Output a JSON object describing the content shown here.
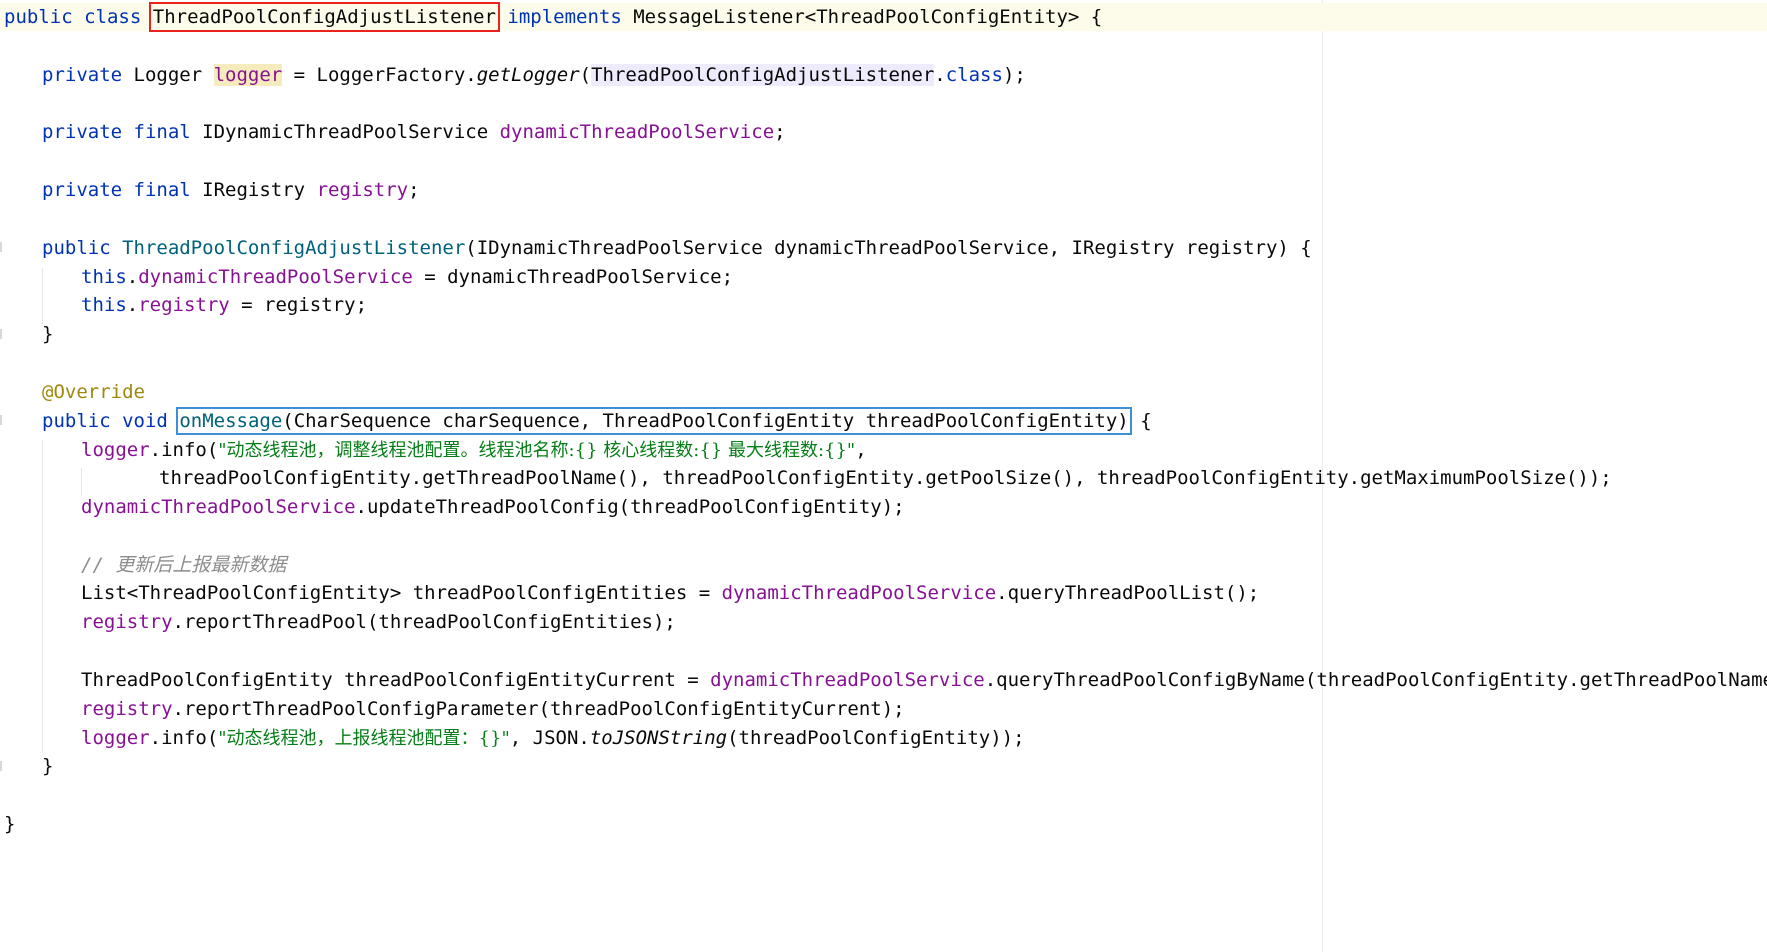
{
  "editor": {
    "language": "Java",
    "lines": [
      {
        "tokens": [
          "public",
          " ",
          "class",
          " ",
          "ThreadPoolConfigAdjustListener",
          " ",
          "implements",
          " ",
          "MessageListener<ThreadPoolConfigEntity> {"
        ]
      },
      {
        "tokens": [
          "private",
          " Logger ",
          "logger",
          " = LoggerFactory.",
          "getLogger",
          "(",
          "ThreadPoolConfigAdjustListener",
          ".",
          "class",
          ");"
        ]
      },
      {
        "tokens": [
          "private",
          " ",
          "final",
          " IDynamicThreadPoolService ",
          "dynamicThreadPoolService",
          ";"
        ]
      },
      {
        "tokens": [
          "private",
          " ",
          "final",
          " IRegistry ",
          "registry",
          ";"
        ]
      },
      {
        "tokens": [
          "public",
          " ",
          "ThreadPoolConfigAdjustListener",
          "(IDynamicThreadPoolService dynamicThreadPoolService, IRegistry registry) {"
        ]
      },
      {
        "tokens": [
          "this",
          ".",
          "dynamicThreadPoolService",
          " = dynamicThreadPoolService;"
        ]
      },
      {
        "tokens": [
          "this",
          ".",
          "registry",
          " = registry;"
        ]
      },
      {
        "tokens": [
          "}"
        ]
      },
      {
        "tokens": [
          "@Override"
        ]
      },
      {
        "tokens": [
          "public",
          " ",
          "void",
          " ",
          "onMessage",
          "(CharSequence charSequence, ThreadPoolConfigEntity threadPoolConfigEntity)",
          " {"
        ]
      },
      {
        "tokens": [
          "logger",
          ".info(",
          "\"动态线程池，调整线程池配置。线程池名称:{} 核心线程数:{} 最大线程数:{}\"",
          ","
        ]
      },
      {
        "tokens": [
          "threadPoolConfigEntity.getThreadPoolName(), threadPoolConfigEntity.getPoolSize(), threadPoolConfigEntity.getMaximumPoolSize());"
        ]
      },
      {
        "tokens": [
          "dynamicThreadPoolService",
          ".updateThreadPoolConfig(threadPoolConfigEntity);"
        ]
      },
      {
        "tokens": [
          "// 更新后上报最新数据"
        ]
      },
      {
        "tokens": [
          "List<ThreadPoolConfigEntity> threadPoolConfigEntities = ",
          "dynamicThreadPoolService",
          ".queryThreadPoolList();"
        ]
      },
      {
        "tokens": [
          "registry",
          ".reportThreadPool(threadPoolConfigEntities);"
        ]
      },
      {
        "tokens": [
          "ThreadPoolConfigEntity threadPoolConfigEntityCurrent = ",
          "dynamicThreadPoolService",
          ".queryThreadPoolConfigByName(threadPoolConfigEntity.getThreadPoolName());"
        ]
      },
      {
        "tokens": [
          "registry",
          ".reportThreadPoolConfigParameter(threadPoolConfigEntityCurrent);"
        ]
      },
      {
        "tokens": [
          "logger",
          ".info(",
          "\"动态线程池，上报线程池配置：{}\"",
          ", JSON.",
          "toJSONString",
          "(threadPoolConfigEntity));"
        ]
      },
      {
        "tokens": [
          "}"
        ]
      },
      {
        "tokens": [
          "}"
        ]
      }
    ]
  },
  "colors": {
    "keyword": "#0033b3",
    "field": "#871094",
    "method_declaration": "#00627a",
    "string": "#067d17",
    "annotation": "#9e880d",
    "comment": "#8c8c8c",
    "highlight_red_box": "#e8241d",
    "highlight_blue_box": "#3d8fd8"
  }
}
